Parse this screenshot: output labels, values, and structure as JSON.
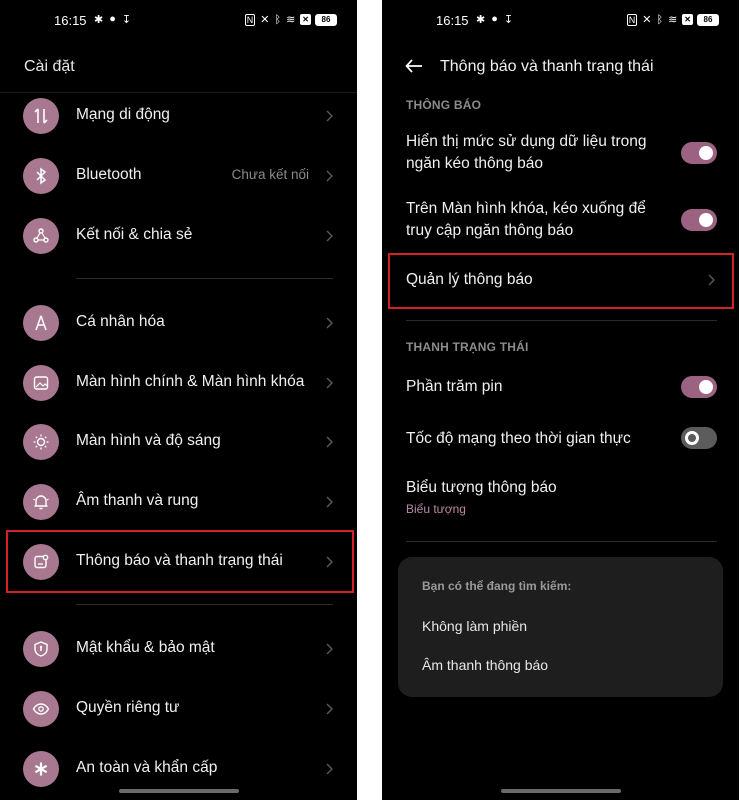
{
  "status_bar": {
    "time": "16:15",
    "battery": "86",
    "left_icons": [
      "gear-icon",
      "messenger-icon",
      "download-icon"
    ],
    "right_icons": [
      "nfc-icon",
      "mute-icon",
      "bluetooth-icon",
      "wifi-icon",
      "sim-off-icon",
      "battery-icon"
    ]
  },
  "left_screen": {
    "title": "Cài đặt",
    "groups": [
      [
        {
          "label": "Mạng di động",
          "icon": "mobile-data-icon",
          "value": ""
        },
        {
          "label": "Bluetooth",
          "icon": "bluetooth-icon",
          "value": "Chưa kết nối"
        },
        {
          "label": "Kết nối & chia sẻ",
          "icon": "share-icon",
          "value": ""
        }
      ],
      [
        {
          "label": "Cá nhân hóa",
          "icon": "compass-icon",
          "value": ""
        },
        {
          "label": "Màn hình chính & Màn hình khóa",
          "icon": "image-icon",
          "value": ""
        },
        {
          "label": "Màn hình và độ sáng",
          "icon": "brightness-icon",
          "value": ""
        },
        {
          "label": "Âm thanh và rung",
          "icon": "bell-icon",
          "value": ""
        },
        {
          "label": "Thông báo và thanh trạng thái",
          "icon": "notification-icon",
          "value": ""
        }
      ],
      [
        {
          "label": "Mật khẩu & bảo mật",
          "icon": "shield-icon",
          "value": ""
        },
        {
          "label": "Quyền riêng tư",
          "icon": "privacy-eye-icon",
          "value": ""
        },
        {
          "label": "An toàn và khẩn cấp",
          "icon": "asterisk-icon",
          "value": ""
        }
      ]
    ]
  },
  "right_screen": {
    "title": "Thông báo và thanh trạng thái",
    "section_notifications": "THÔNG BÁO",
    "toggle_data_usage": {
      "label": "Hiển thị mức sử dụng dữ liệu trong ngăn kéo thông báo",
      "on": true
    },
    "toggle_lockscreen": {
      "label": "Trên Màn hình khóa, kéo xuống để truy cập ngăn thông báo",
      "on": true
    },
    "manage_notifications": "Quản lý thông báo",
    "section_status_bar": "THANH TRẠNG THÁI",
    "toggle_battery_percent": {
      "label": "Phần trăm pin",
      "on": true
    },
    "toggle_network_speed": {
      "label": "Tốc độ mạng theo thời gian thực",
      "on": false
    },
    "notification_icons": {
      "label": "Biểu tượng thông báo",
      "value": "Biểu tượng"
    },
    "suggestion_card": {
      "title": "Bạn có thể đang tìm kiếm:",
      "items": [
        "Không làm phiền",
        "Âm thanh thông báo"
      ]
    }
  },
  "colors": {
    "accent": "#9c6282",
    "icon_bg": "#a87890",
    "highlight": "#d61f26"
  }
}
